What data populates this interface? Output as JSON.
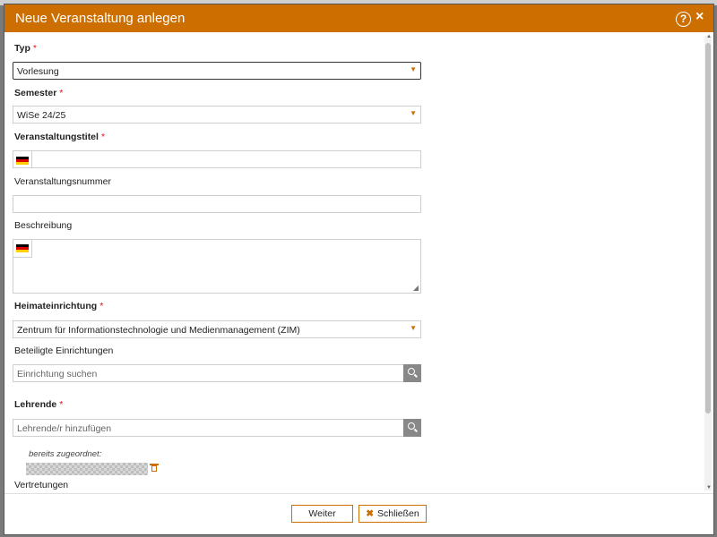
{
  "dialog": {
    "title": "Neue Veranstaltung anlegen",
    "help_icon": "?",
    "close_icon": "×"
  },
  "form": {
    "typ": {
      "label": "Typ",
      "required": "*",
      "value": "Vorlesung"
    },
    "semester": {
      "label": "Semester",
      "required": "*",
      "value": "WiSe 24/25"
    },
    "titel": {
      "label": "Veranstaltungstitel",
      "required": "*",
      "value": ""
    },
    "nummer": {
      "label": "Veranstaltungsnummer",
      "value": ""
    },
    "beschreibung": {
      "label": "Beschreibung",
      "value": ""
    },
    "heimateinrichtung": {
      "label": "Heimateinrichtung",
      "required": "*",
      "value": "Zentrum für Informationstechnologie und Medienmanagement (ZIM)"
    },
    "beteiligte": {
      "label": "Beteiligte Einrichtungen",
      "placeholder": "Einrichtung suchen"
    },
    "lehrende": {
      "label": "Lehrende",
      "required": "*",
      "placeholder": "Lehrende/r hinzufügen",
      "assigned_label": "bereits zugeordnet:"
    },
    "vertretungen": {
      "label": "Vertretungen"
    }
  },
  "footer": {
    "next_label": "Weiter",
    "close_glyph": "✖",
    "close_label": "Schließen"
  },
  "colors": {
    "accent": "#cc6e00",
    "required": "#dd1111"
  },
  "icons": {
    "flag": "german-flag-icon",
    "search": "search-icon",
    "trash": "trash-icon",
    "chevron": "chevron-down-icon"
  }
}
